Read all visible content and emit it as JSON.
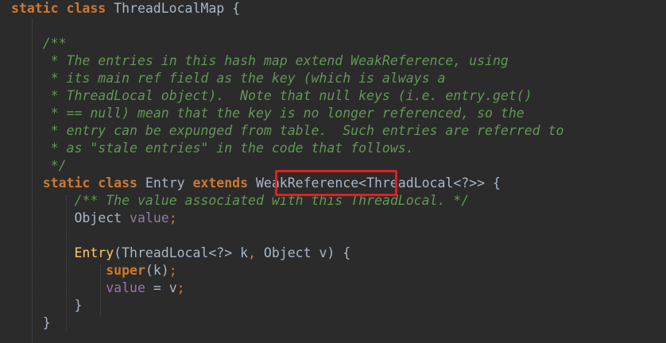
{
  "editor": {
    "theme_colors": {
      "background": "#2b2b2b",
      "keyword": "#cc7832",
      "doc_comment": "#629755",
      "field": "#9876aa",
      "method": "#ffc66d",
      "plain": "#a9b7c6",
      "highlight_border": "#e0201c"
    },
    "lines": [
      {
        "indent": "",
        "tokens": [
          {
            "t": "static class ",
            "c": "kw"
          },
          {
            "t": "ThreadLocalMap {",
            "c": "plain"
          }
        ]
      },
      {
        "indent": "",
        "tokens": []
      },
      {
        "indent": "    ",
        "tokens": [
          {
            "t": "/**",
            "c": "doc"
          }
        ]
      },
      {
        "indent": "    ",
        "tokens": [
          {
            "t": " * The entries in this hash map extend WeakReference, using",
            "c": "doc"
          }
        ]
      },
      {
        "indent": "    ",
        "tokens": [
          {
            "t": " * its main ref field as the key (which is always a",
            "c": "doc"
          }
        ]
      },
      {
        "indent": "    ",
        "tokens": [
          {
            "t": " * ThreadLocal object).  Note that null keys (i.e. entry.get()",
            "c": "doc"
          }
        ]
      },
      {
        "indent": "    ",
        "tokens": [
          {
            "t": " * == null) mean that the key is no longer referenced, so the",
            "c": "doc"
          }
        ]
      },
      {
        "indent": "    ",
        "tokens": [
          {
            "t": " * entry can be expunged from table.  Such entries are referred to",
            "c": "doc"
          }
        ]
      },
      {
        "indent": "    ",
        "tokens": [
          {
            "t": " * as \"stale entries\" in the code that follows.",
            "c": "doc"
          }
        ]
      },
      {
        "indent": "    ",
        "tokens": [
          {
            "t": " */",
            "c": "doc"
          }
        ]
      },
      {
        "indent": "    ",
        "tokens": [
          {
            "t": "static class ",
            "c": "kw"
          },
          {
            "t": "Entry ",
            "c": "plain"
          },
          {
            "t": "extends ",
            "c": "kw"
          },
          {
            "t": "WeakReference",
            "c": "plain"
          },
          {
            "t": "<ThreadLocal<?>> {",
            "c": "plain"
          }
        ]
      },
      {
        "indent": "        ",
        "tokens": [
          {
            "t": "/** The value associated with this ThreadLocal. */",
            "c": "doc"
          }
        ]
      },
      {
        "indent": "        ",
        "tokens": [
          {
            "t": "Object ",
            "c": "plain"
          },
          {
            "t": "value",
            "c": "field"
          },
          {
            "t": ";",
            "c": "punct"
          }
        ]
      },
      {
        "indent": "",
        "tokens": []
      },
      {
        "indent": "        ",
        "tokens": [
          {
            "t": "Entry",
            "c": "method"
          },
          {
            "t": "(ThreadLocal<?> k",
            "c": "plain"
          },
          {
            "t": ", ",
            "c": "punct"
          },
          {
            "t": "Object v) {",
            "c": "plain"
          }
        ]
      },
      {
        "indent": "            ",
        "tokens": [
          {
            "t": "super",
            "c": "kw"
          },
          {
            "t": "(k)",
            "c": "plain"
          },
          {
            "t": ";",
            "c": "punct"
          }
        ]
      },
      {
        "indent": "            ",
        "tokens": [
          {
            "t": "value",
            "c": "field"
          },
          {
            "t": " = v",
            "c": "plain"
          },
          {
            "t": ";",
            "c": "punct"
          }
        ]
      },
      {
        "indent": "        ",
        "tokens": [
          {
            "t": "}",
            "c": "plain"
          }
        ]
      },
      {
        "indent": "    ",
        "tokens": [
          {
            "t": "}",
            "c": "plain"
          }
        ]
      }
    ],
    "highlighted_token": "WeakReference"
  }
}
